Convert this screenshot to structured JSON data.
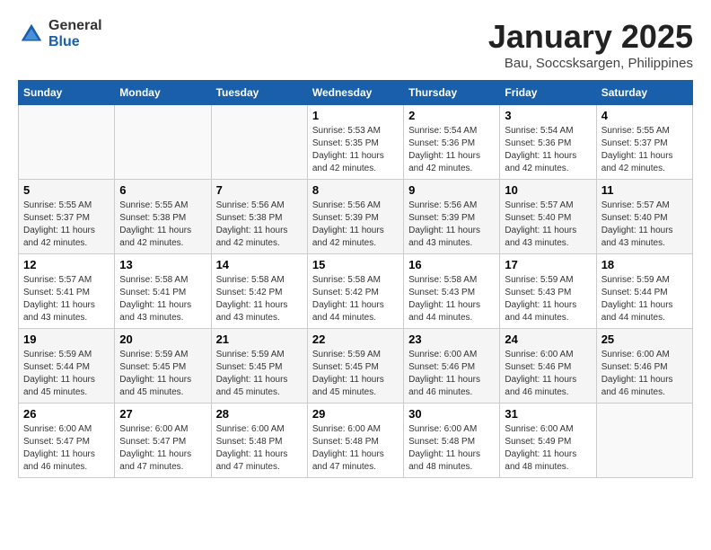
{
  "logo": {
    "general": "General",
    "blue": "Blue"
  },
  "title": "January 2025",
  "subtitle": "Bau, Soccsksargen, Philippines",
  "days_header": [
    "Sunday",
    "Monday",
    "Tuesday",
    "Wednesday",
    "Thursday",
    "Friday",
    "Saturday"
  ],
  "weeks": [
    [
      {
        "day": null,
        "sunrise": null,
        "sunset": null,
        "daylight": null
      },
      {
        "day": null,
        "sunrise": null,
        "sunset": null,
        "daylight": null
      },
      {
        "day": null,
        "sunrise": null,
        "sunset": null,
        "daylight": null
      },
      {
        "day": "1",
        "sunrise": "Sunrise: 5:53 AM",
        "sunset": "Sunset: 5:35 PM",
        "daylight": "Daylight: 11 hours and 42 minutes."
      },
      {
        "day": "2",
        "sunrise": "Sunrise: 5:54 AM",
        "sunset": "Sunset: 5:36 PM",
        "daylight": "Daylight: 11 hours and 42 minutes."
      },
      {
        "day": "3",
        "sunrise": "Sunrise: 5:54 AM",
        "sunset": "Sunset: 5:36 PM",
        "daylight": "Daylight: 11 hours and 42 minutes."
      },
      {
        "day": "4",
        "sunrise": "Sunrise: 5:55 AM",
        "sunset": "Sunset: 5:37 PM",
        "daylight": "Daylight: 11 hours and 42 minutes."
      }
    ],
    [
      {
        "day": "5",
        "sunrise": "Sunrise: 5:55 AM",
        "sunset": "Sunset: 5:37 PM",
        "daylight": "Daylight: 11 hours and 42 minutes."
      },
      {
        "day": "6",
        "sunrise": "Sunrise: 5:55 AM",
        "sunset": "Sunset: 5:38 PM",
        "daylight": "Daylight: 11 hours and 42 minutes."
      },
      {
        "day": "7",
        "sunrise": "Sunrise: 5:56 AM",
        "sunset": "Sunset: 5:38 PM",
        "daylight": "Daylight: 11 hours and 42 minutes."
      },
      {
        "day": "8",
        "sunrise": "Sunrise: 5:56 AM",
        "sunset": "Sunset: 5:39 PM",
        "daylight": "Daylight: 11 hours and 42 minutes."
      },
      {
        "day": "9",
        "sunrise": "Sunrise: 5:56 AM",
        "sunset": "Sunset: 5:39 PM",
        "daylight": "Daylight: 11 hours and 43 minutes."
      },
      {
        "day": "10",
        "sunrise": "Sunrise: 5:57 AM",
        "sunset": "Sunset: 5:40 PM",
        "daylight": "Daylight: 11 hours and 43 minutes."
      },
      {
        "day": "11",
        "sunrise": "Sunrise: 5:57 AM",
        "sunset": "Sunset: 5:40 PM",
        "daylight": "Daylight: 11 hours and 43 minutes."
      }
    ],
    [
      {
        "day": "12",
        "sunrise": "Sunrise: 5:57 AM",
        "sunset": "Sunset: 5:41 PM",
        "daylight": "Daylight: 11 hours and 43 minutes."
      },
      {
        "day": "13",
        "sunrise": "Sunrise: 5:58 AM",
        "sunset": "Sunset: 5:41 PM",
        "daylight": "Daylight: 11 hours and 43 minutes."
      },
      {
        "day": "14",
        "sunrise": "Sunrise: 5:58 AM",
        "sunset": "Sunset: 5:42 PM",
        "daylight": "Daylight: 11 hours and 43 minutes."
      },
      {
        "day": "15",
        "sunrise": "Sunrise: 5:58 AM",
        "sunset": "Sunset: 5:42 PM",
        "daylight": "Daylight: 11 hours and 44 minutes."
      },
      {
        "day": "16",
        "sunrise": "Sunrise: 5:58 AM",
        "sunset": "Sunset: 5:43 PM",
        "daylight": "Daylight: 11 hours and 44 minutes."
      },
      {
        "day": "17",
        "sunrise": "Sunrise: 5:59 AM",
        "sunset": "Sunset: 5:43 PM",
        "daylight": "Daylight: 11 hours and 44 minutes."
      },
      {
        "day": "18",
        "sunrise": "Sunrise: 5:59 AM",
        "sunset": "Sunset: 5:44 PM",
        "daylight": "Daylight: 11 hours and 44 minutes."
      }
    ],
    [
      {
        "day": "19",
        "sunrise": "Sunrise: 5:59 AM",
        "sunset": "Sunset: 5:44 PM",
        "daylight": "Daylight: 11 hours and 45 minutes."
      },
      {
        "day": "20",
        "sunrise": "Sunrise: 5:59 AM",
        "sunset": "Sunset: 5:45 PM",
        "daylight": "Daylight: 11 hours and 45 minutes."
      },
      {
        "day": "21",
        "sunrise": "Sunrise: 5:59 AM",
        "sunset": "Sunset: 5:45 PM",
        "daylight": "Daylight: 11 hours and 45 minutes."
      },
      {
        "day": "22",
        "sunrise": "Sunrise: 5:59 AM",
        "sunset": "Sunset: 5:45 PM",
        "daylight": "Daylight: 11 hours and 45 minutes."
      },
      {
        "day": "23",
        "sunrise": "Sunrise: 6:00 AM",
        "sunset": "Sunset: 5:46 PM",
        "daylight": "Daylight: 11 hours and 46 minutes."
      },
      {
        "day": "24",
        "sunrise": "Sunrise: 6:00 AM",
        "sunset": "Sunset: 5:46 PM",
        "daylight": "Daylight: 11 hours and 46 minutes."
      },
      {
        "day": "25",
        "sunrise": "Sunrise: 6:00 AM",
        "sunset": "Sunset: 5:46 PM",
        "daylight": "Daylight: 11 hours and 46 minutes."
      }
    ],
    [
      {
        "day": "26",
        "sunrise": "Sunrise: 6:00 AM",
        "sunset": "Sunset: 5:47 PM",
        "daylight": "Daylight: 11 hours and 46 minutes."
      },
      {
        "day": "27",
        "sunrise": "Sunrise: 6:00 AM",
        "sunset": "Sunset: 5:47 PM",
        "daylight": "Daylight: 11 hours and 47 minutes."
      },
      {
        "day": "28",
        "sunrise": "Sunrise: 6:00 AM",
        "sunset": "Sunset: 5:48 PM",
        "daylight": "Daylight: 11 hours and 47 minutes."
      },
      {
        "day": "29",
        "sunrise": "Sunrise: 6:00 AM",
        "sunset": "Sunset: 5:48 PM",
        "daylight": "Daylight: 11 hours and 47 minutes."
      },
      {
        "day": "30",
        "sunrise": "Sunrise: 6:00 AM",
        "sunset": "Sunset: 5:48 PM",
        "daylight": "Daylight: 11 hours and 48 minutes."
      },
      {
        "day": "31",
        "sunrise": "Sunrise: 6:00 AM",
        "sunset": "Sunset: 5:49 PM",
        "daylight": "Daylight: 11 hours and 48 minutes."
      },
      {
        "day": null,
        "sunrise": null,
        "sunset": null,
        "daylight": null
      }
    ]
  ]
}
